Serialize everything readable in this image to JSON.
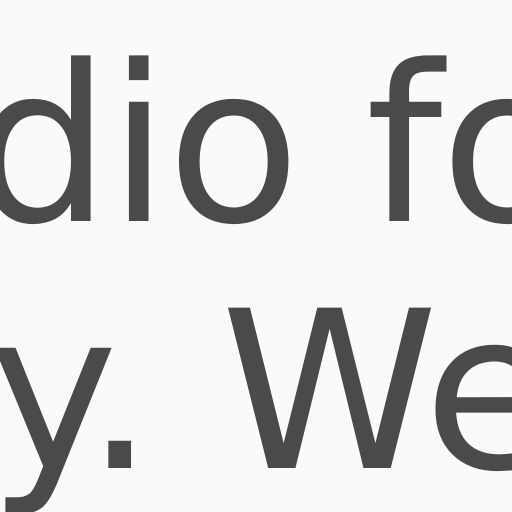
{
  "content": {
    "line1": "dio fo",
    "line2": "y. We"
  },
  "colors": {
    "background": "#fafafa",
    "text": "#4a4a4a"
  }
}
